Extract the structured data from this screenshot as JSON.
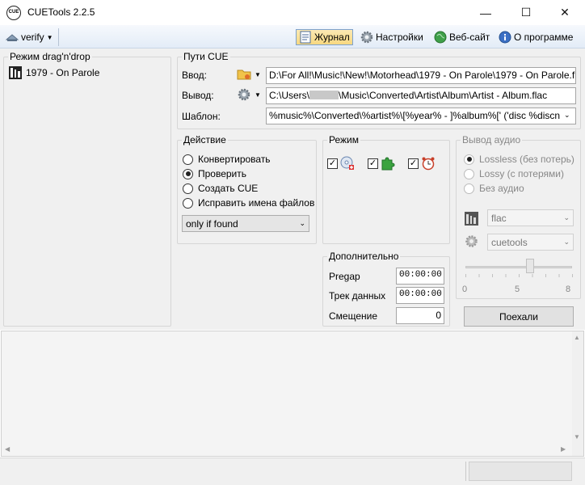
{
  "window": {
    "title": "CUETools 2.2.5",
    "app_icon_text": "CUE"
  },
  "toolbar": {
    "profile": "verify",
    "items": [
      {
        "label": "Журнал",
        "icon": "log-icon"
      },
      {
        "label": "Настройки",
        "icon": "gear-icon"
      },
      {
        "label": "Веб-сайт",
        "icon": "globe-icon"
      },
      {
        "label": "О программе",
        "icon": "info-icon"
      }
    ]
  },
  "dragdrop": {
    "title": "Режим drag'n'drop",
    "items": [
      "1979 - On Parole"
    ]
  },
  "paths": {
    "title": "Пути CUE",
    "input_label": "Ввод:",
    "input_value": "D:\\For All!\\Music!\\New!\\Motorhead\\1979 - On Parole\\1979 - On Parole.flac",
    "output_label": "Вывод:",
    "output_value_prefix": "C:\\Users\\",
    "output_value_suffix": "\\Music\\Converted\\Artist\\Album\\Artist - Album.flac",
    "template_label": "Шаблон:",
    "template_value": "%music%\\Converted\\%artist%\\[%year% - ]%album%[' ('disc %discn"
  },
  "action": {
    "title": "Действие",
    "options": [
      {
        "label": "Конвертировать",
        "checked": false
      },
      {
        "label": "Проверить",
        "checked": true
      },
      {
        "label": "Создать CUE",
        "checked": false
      },
      {
        "label": "Исправить имена файлов",
        "checked": false
      }
    ],
    "dropdown_value": "only if found"
  },
  "mode": {
    "title": "Режим",
    "checks": [
      {
        "checked": true,
        "icon": "cd-add-icon"
      },
      {
        "checked": true,
        "icon": "puzzle-icon"
      },
      {
        "checked": true,
        "icon": "alarm-clock-icon"
      }
    ]
  },
  "extra": {
    "title": "Дополнительно",
    "pregap_label": "Pregap",
    "pregap_value": "00:00:00",
    "data_track_label": "Трек данных",
    "data_track_value": "00:00:00",
    "offset_label": "Смещение",
    "offset_value": "0"
  },
  "audio_out": {
    "title": "Вывод аудио",
    "options": [
      {
        "label": "Lossless (без потерь)",
        "checked": true
      },
      {
        "label": "Lossy (с потерями)",
        "checked": false
      },
      {
        "label": "Без аудио",
        "checked": false
      }
    ],
    "format_value": "flac",
    "encoder_value": "cuetools",
    "slider_ticks": [
      "0",
      "5",
      "8"
    ],
    "slider_value": 6
  },
  "go_button": "Поехали",
  "colors": {
    "toolbar_active": "#f7d880",
    "group_border": "#d6d6d6",
    "window_bg": "#f0f0f0"
  }
}
